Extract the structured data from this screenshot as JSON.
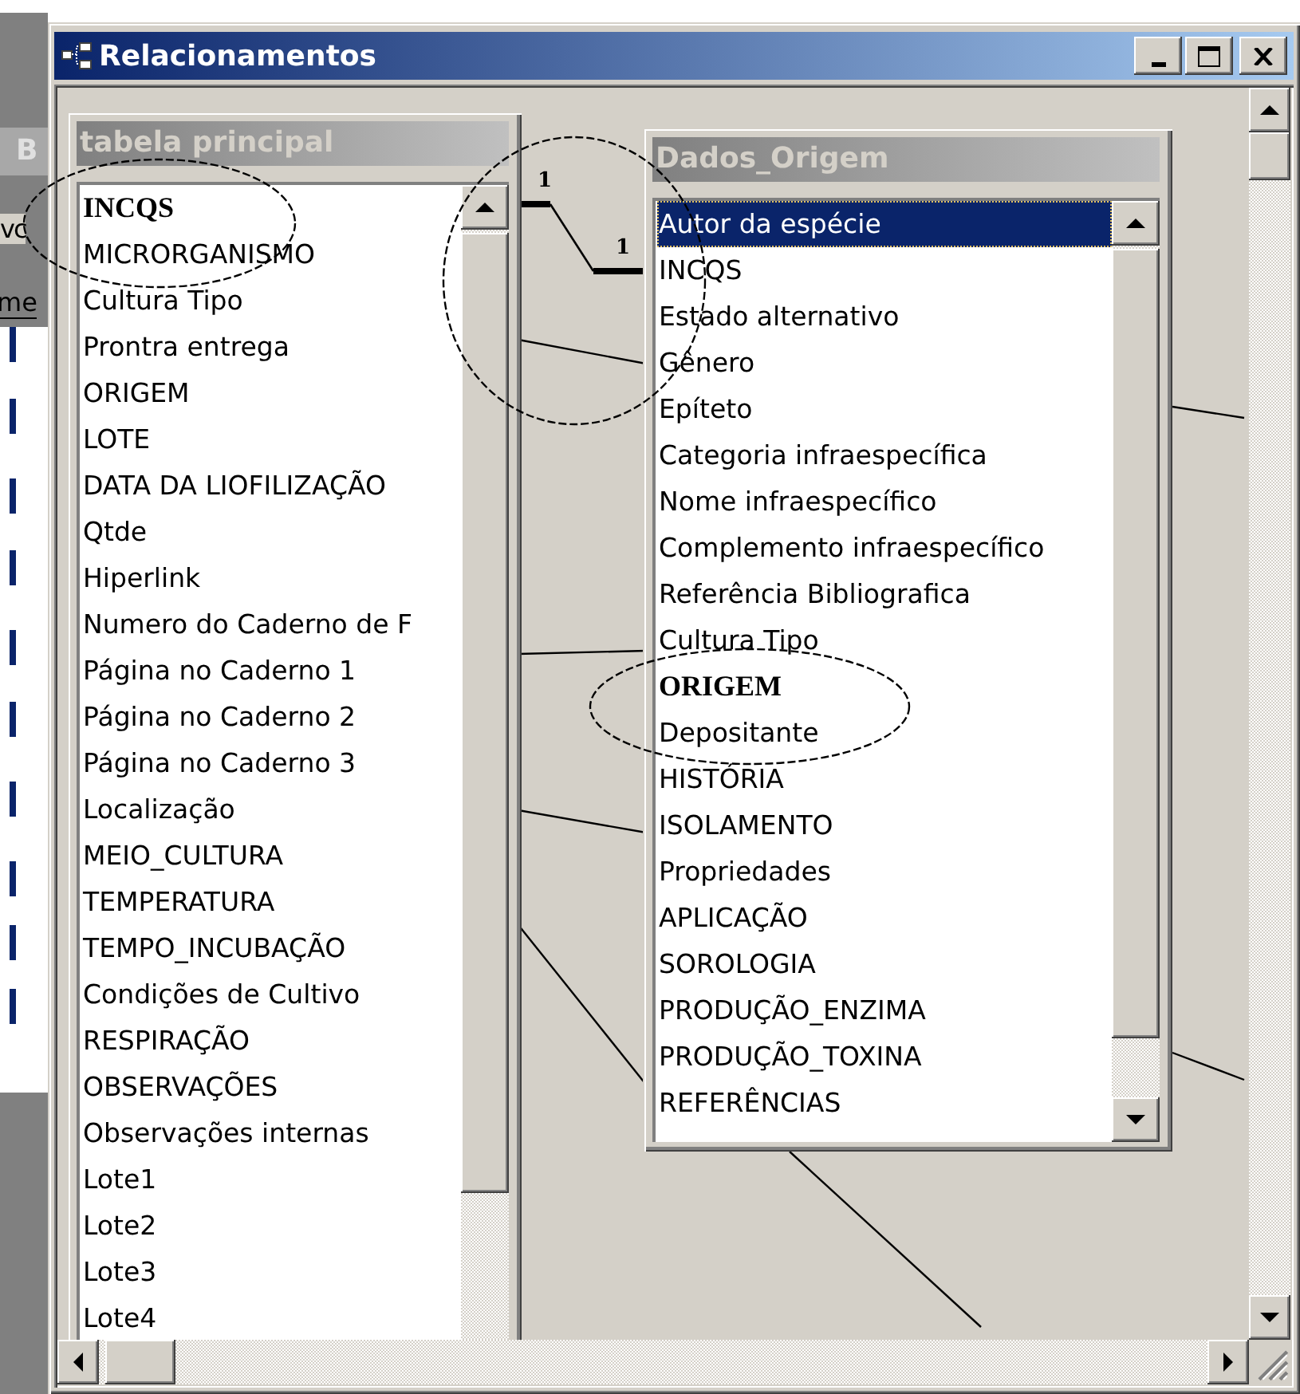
{
  "background_window": {
    "texts": [
      "B",
      "vc",
      "me"
    ]
  },
  "window": {
    "title": "Relacionamentos"
  },
  "relationships": {
    "labels": [
      "1",
      "1"
    ]
  },
  "tables": [
    {
      "title": "tabela principal",
      "active": false,
      "fields": [
        {
          "name": "INCQS",
          "key": true,
          "selected": false
        },
        {
          "name": "MICRORGANISMO",
          "key": false,
          "selected": false
        },
        {
          "name": "Cultura Tipo",
          "key": false,
          "selected": false
        },
        {
          "name": "Prontra entrega",
          "key": false,
          "selected": false
        },
        {
          "name": "ORIGEM",
          "key": false,
          "selected": false
        },
        {
          "name": "LOTE",
          "key": false,
          "selected": false
        },
        {
          "name": "DATA DA LIOFILIZAÇÃO",
          "key": false,
          "selected": false
        },
        {
          "name": "Qtde",
          "key": false,
          "selected": false
        },
        {
          "name": "Hiperlink",
          "key": false,
          "selected": false
        },
        {
          "name": "Numero do Caderno de F",
          "key": false,
          "selected": false
        },
        {
          "name": "Página no Caderno 1",
          "key": false,
          "selected": false
        },
        {
          "name": "Página no Caderno 2",
          "key": false,
          "selected": false
        },
        {
          "name": "Página no Caderno 3",
          "key": false,
          "selected": false
        },
        {
          "name": "Localização",
          "key": false,
          "selected": false
        },
        {
          "name": "MEIO_CULTURA",
          "key": false,
          "selected": false
        },
        {
          "name": "TEMPERATURA",
          "key": false,
          "selected": false
        },
        {
          "name": "TEMPO_INCUBAÇÃO",
          "key": false,
          "selected": false
        },
        {
          "name": "Condições de Cultivo",
          "key": false,
          "selected": false
        },
        {
          "name": "RESPIRAÇÃO",
          "key": false,
          "selected": false
        },
        {
          "name": "OBSERVAÇÕES",
          "key": false,
          "selected": false
        },
        {
          "name": "Observações internas",
          "key": false,
          "selected": false
        },
        {
          "name": "Lote1",
          "key": false,
          "selected": false
        },
        {
          "name": "Lote2",
          "key": false,
          "selected": false
        },
        {
          "name": "Lote3",
          "key": false,
          "selected": false
        },
        {
          "name": "Lote4",
          "key": false,
          "selected": false
        }
      ]
    },
    {
      "title": "Dados_Origem",
      "active": false,
      "fields": [
        {
          "name": "Autor da espécie",
          "key": false,
          "selected": true
        },
        {
          "name": "INCQS",
          "key": false,
          "selected": false
        },
        {
          "name": "Estado alternativo",
          "key": false,
          "selected": false
        },
        {
          "name": "Gênero",
          "key": false,
          "selected": false
        },
        {
          "name": "Epíteto",
          "key": false,
          "selected": false
        },
        {
          "name": "Categoria infraespecífica",
          "key": false,
          "selected": false
        },
        {
          "name": "Nome infraespecífico",
          "key": false,
          "selected": false
        },
        {
          "name": "Complemento infraespecífico",
          "key": false,
          "selected": false
        },
        {
          "name": "Referência Bibliografica",
          "key": false,
          "selected": false
        },
        {
          "name": "Cultura Tipo",
          "key": false,
          "selected": false
        },
        {
          "name": "ORIGEM",
          "key": true,
          "selected": false
        },
        {
          "name": "Depositante",
          "key": false,
          "selected": false
        },
        {
          "name": "HISTÓRIA",
          "key": false,
          "selected": false
        },
        {
          "name": "ISOLAMENTO",
          "key": false,
          "selected": false
        },
        {
          "name": "Propriedades",
          "key": false,
          "selected": false
        },
        {
          "name": "APLICAÇÃO",
          "key": false,
          "selected": false
        },
        {
          "name": "SOROLOGIA",
          "key": false,
          "selected": false
        },
        {
          "name": "PRODUÇÃO_ENZIMA",
          "key": false,
          "selected": false
        },
        {
          "name": "PRODUÇÃO_TOXINA",
          "key": false,
          "selected": false
        },
        {
          "name": "REFERÊNCIAS",
          "key": false,
          "selected": false
        }
      ]
    }
  ]
}
